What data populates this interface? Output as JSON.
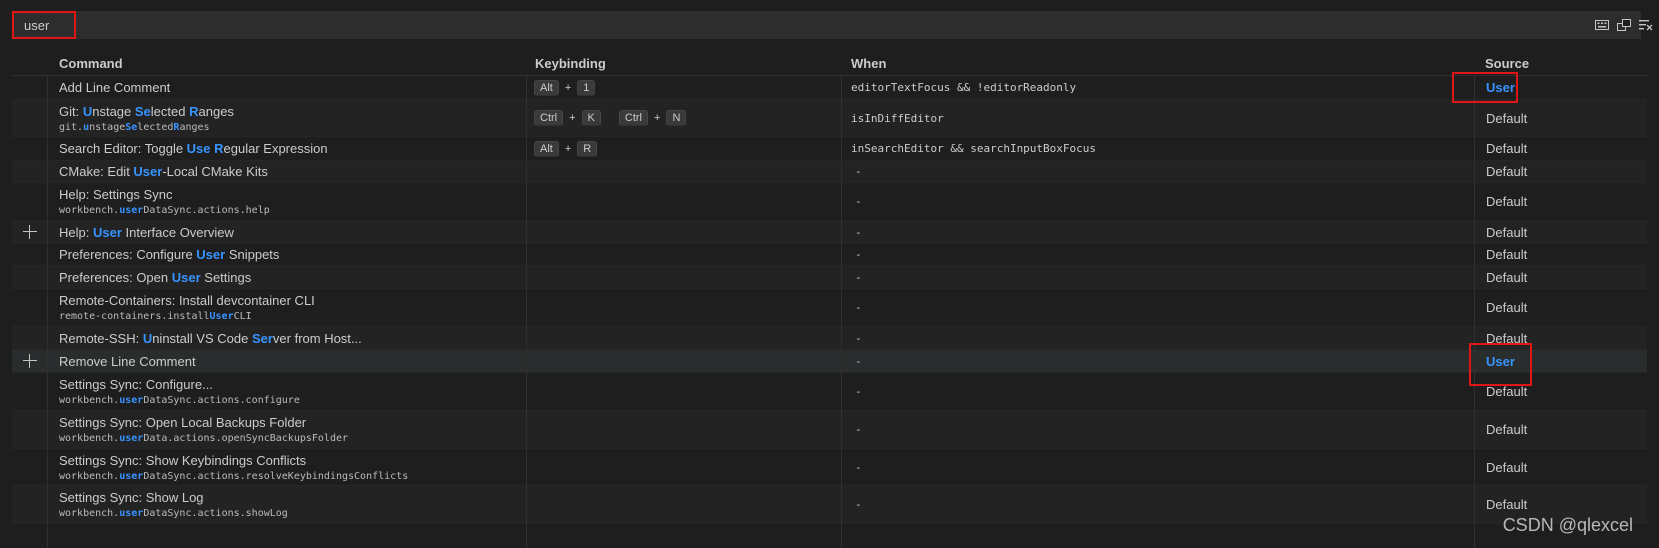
{
  "search": {
    "value": "user"
  },
  "columns": {
    "command": "Command",
    "keybinding": "Keybinding",
    "when": "When",
    "source": "Source"
  },
  "rows": [
    {
      "command_parts": [
        {
          "t": "Add Line Comment",
          "h": false
        }
      ],
      "id_parts": [],
      "keys": [
        [
          "Alt",
          "1"
        ]
      ],
      "when": "editorTextFocus && !editorReadonly",
      "source": "User",
      "source_user": true,
      "style": "",
      "show_add": false,
      "height": 24
    },
    {
      "command_parts": [
        {
          "t": "Git: ",
          "h": false
        },
        {
          "t": "U",
          "h": true
        },
        {
          "t": "nstage ",
          "h": false
        },
        {
          "t": "Se",
          "h": true
        },
        {
          "t": "lected ",
          "h": false
        },
        {
          "t": "R",
          "h": true
        },
        {
          "t": "anges",
          "h": false
        }
      ],
      "id_parts": [
        {
          "t": "git.",
          "h": false
        },
        {
          "t": "u",
          "h": true
        },
        {
          "t": "nstage",
          "h": false
        },
        {
          "t": "Se",
          "h": true
        },
        {
          "t": "lected",
          "h": false
        },
        {
          "t": "R",
          "h": true
        },
        {
          "t": "anges",
          "h": false
        }
      ],
      "keys": [
        [
          "Ctrl",
          "K"
        ],
        [
          "Ctrl",
          "N"
        ]
      ],
      "when": "isInDiffEditor",
      "source": "Default",
      "source_user": false,
      "style": "alt",
      "show_add": false,
      "height": 37
    },
    {
      "command_parts": [
        {
          "t": "Search Editor: Toggle ",
          "h": false
        },
        {
          "t": "Use R",
          "h": true
        },
        {
          "t": "egular Expression",
          "h": false
        }
      ],
      "id_parts": [],
      "keys": [
        [
          "Alt",
          "R"
        ]
      ],
      "when": "inSearchEditor && searchInputBoxFocus",
      "source": "Default",
      "source_user": false,
      "style": "",
      "show_add": false,
      "height": 24
    },
    {
      "command_parts": [
        {
          "t": "CMake: Edit ",
          "h": false
        },
        {
          "t": "User",
          "h": true
        },
        {
          "t": "-Local CMake Kits",
          "h": false
        }
      ],
      "id_parts": [],
      "keys": [],
      "when": "-",
      "source": "Default",
      "source_user": false,
      "style": "alt",
      "show_add": false,
      "height": 22
    },
    {
      "command_parts": [
        {
          "t": "Help: Settings Sync",
          "h": false
        }
      ],
      "id_parts": [
        {
          "t": "workbench.",
          "h": false
        },
        {
          "t": "user",
          "h": true
        },
        {
          "t": "DataSync.actions.help",
          "h": false
        }
      ],
      "keys": [],
      "when": "-",
      "source": "Default",
      "source_user": false,
      "style": "",
      "show_add": false,
      "height": 38
    },
    {
      "command_parts": [
        {
          "t": "Help: ",
          "h": false
        },
        {
          "t": "User",
          "h": true
        },
        {
          "t": " Interface Overview",
          "h": false
        }
      ],
      "id_parts": [],
      "keys": [],
      "when": "-",
      "source": "Default",
      "source_user": false,
      "style": "alt",
      "show_add": true,
      "height": 23
    },
    {
      "command_parts": [
        {
          "t": "Preferences: Configure ",
          "h": false
        },
        {
          "t": "User",
          "h": true
        },
        {
          "t": " Snippets",
          "h": false
        }
      ],
      "id_parts": [],
      "keys": [],
      "when": "-",
      "source": "Default",
      "source_user": false,
      "style": "",
      "show_add": false,
      "height": 22
    },
    {
      "command_parts": [
        {
          "t": "Preferences: Open ",
          "h": false
        },
        {
          "t": "User",
          "h": true
        },
        {
          "t": " Settings",
          "h": false
        }
      ],
      "id_parts": [],
      "keys": [],
      "when": "-",
      "source": "Default",
      "source_user": false,
      "style": "alt",
      "show_add": false,
      "height": 23
    },
    {
      "command_parts": [
        {
          "t": "Remote-Containers: Install devcontainer CLI",
          "h": false
        }
      ],
      "id_parts": [
        {
          "t": "remote-containers.install",
          "h": false
        },
        {
          "t": "User",
          "h": true
        },
        {
          "t": "CLI",
          "h": false
        }
      ],
      "keys": [],
      "when": "-",
      "source": "Default",
      "source_user": false,
      "style": "",
      "show_add": false,
      "height": 38
    },
    {
      "command_parts": [
        {
          "t": "Remote-SSH: ",
          "h": false
        },
        {
          "t": "U",
          "h": true
        },
        {
          "t": "ninstall VS Code ",
          "h": false
        },
        {
          "t": "Ser",
          "h": true
        },
        {
          "t": "ver from Host...",
          "h": false
        }
      ],
      "id_parts": [],
      "keys": [],
      "when": "-",
      "source": "Default",
      "source_user": false,
      "style": "alt",
      "show_add": false,
      "height": 23
    },
    {
      "command_parts": [
        {
          "t": "Remove Line Comment",
          "h": false
        }
      ],
      "id_parts": [],
      "keys": [],
      "when": "-",
      "source": "User",
      "source_user": true,
      "style": "focused",
      "show_add": true,
      "height": 23
    },
    {
      "command_parts": [
        {
          "t": "Settings Sync: Configure...",
          "h": false
        }
      ],
      "id_parts": [
        {
          "t": "workbench.",
          "h": false
        },
        {
          "t": "user",
          "h": true
        },
        {
          "t": "DataSync.actions.configure",
          "h": false
        }
      ],
      "keys": [],
      "when": "-",
      "source": "Default",
      "source_user": false,
      "style": "",
      "show_add": false,
      "height": 38
    },
    {
      "command_parts": [
        {
          "t": "Settings Sync: Open Local Backups Folder",
          "h": false
        }
      ],
      "id_parts": [
        {
          "t": "workbench.",
          "h": false
        },
        {
          "t": "user",
          "h": true
        },
        {
          "t": "Data.actions.openSyncBackupsFolder",
          "h": false
        }
      ],
      "keys": [],
      "when": "-",
      "source": "Default",
      "source_user": false,
      "style": "alt",
      "show_add": false,
      "height": 38
    },
    {
      "command_parts": [
        {
          "t": "Settings Sync: Show Keybindings Conflicts",
          "h": false
        }
      ],
      "id_parts": [
        {
          "t": "workbench.",
          "h": false
        },
        {
          "t": "user",
          "h": true
        },
        {
          "t": "DataSync.actions.resolveKeybindingsConflicts",
          "h": false
        }
      ],
      "keys": [],
      "when": "-",
      "source": "Default",
      "source_user": false,
      "style": "",
      "show_add": false,
      "height": 37
    },
    {
      "command_parts": [
        {
          "t": "Settings Sync: Show Log",
          "h": false
        }
      ],
      "id_parts": [
        {
          "t": "workbench.",
          "h": false
        },
        {
          "t": "user",
          "h": true
        },
        {
          "t": "DataSync.actions.showLog",
          "h": false
        }
      ],
      "keys": [],
      "when": "-",
      "source": "Default",
      "source_user": false,
      "style": "alt",
      "show_add": false,
      "height": 38
    }
  ],
  "watermark": "CSDN @qlexcel",
  "colors": {
    "highlight": "#3794ff",
    "annotation_red": "#e01515",
    "background": "#1e1e1e"
  }
}
